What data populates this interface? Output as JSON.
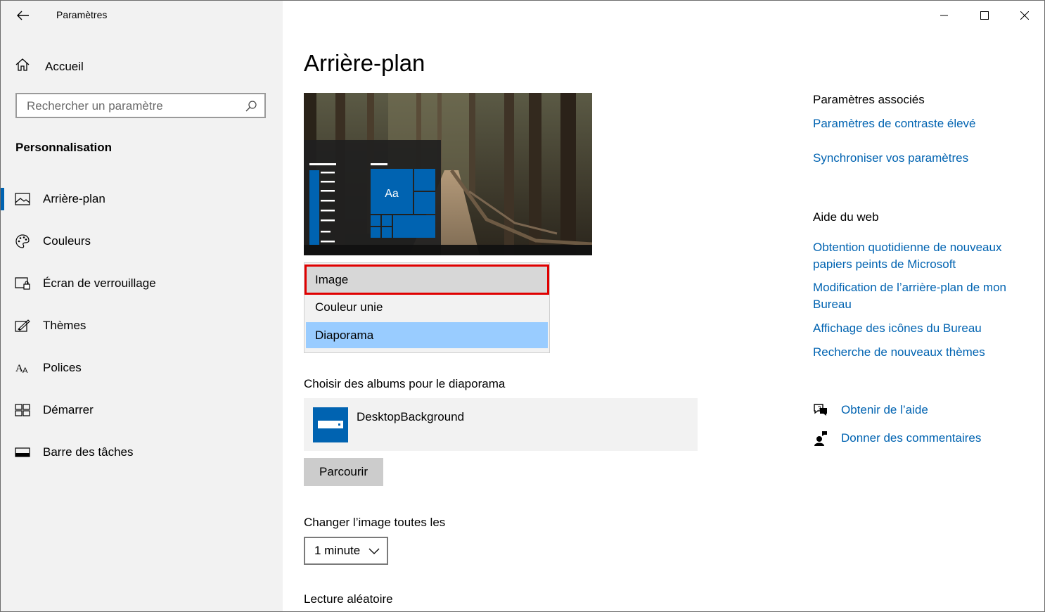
{
  "window": {
    "title": "Paramètres",
    "controls": [
      "minimize",
      "maximize",
      "close"
    ]
  },
  "sidebar": {
    "home_label": "Accueil",
    "search_placeholder": "Rechercher un paramètre",
    "section_title": "Personnalisation",
    "items": [
      {
        "label": "Arrière-plan",
        "icon": "picture-icon",
        "selected": true
      },
      {
        "label": "Couleurs",
        "icon": "palette-icon",
        "selected": false
      },
      {
        "label": "Écran de verrouillage",
        "icon": "lock-screen-icon",
        "selected": false
      },
      {
        "label": "Thèmes",
        "icon": "themes-icon",
        "selected": false
      },
      {
        "label": "Polices",
        "icon": "fonts-icon",
        "selected": false
      },
      {
        "label": "Démarrer",
        "icon": "start-icon",
        "selected": false
      },
      {
        "label": "Barre des tâches",
        "icon": "taskbar-icon",
        "selected": false
      }
    ]
  },
  "main": {
    "title": "Arrière-plan",
    "preview_tile_text": "Aa",
    "background_dropdown": {
      "options": [
        "Image",
        "Couleur unie",
        "Diaporama"
      ],
      "highlighted": "Image",
      "selected": "Diaporama"
    },
    "albums_label": "Choisir des albums pour le diaporama",
    "album_name": "DesktopBackground",
    "browse_button": "Parcourir",
    "interval_label": "Changer l’image toutes les",
    "interval_value": "1 minute",
    "shuffle_label": "Lecture aléatoire"
  },
  "related": {
    "heading": "Paramètres associés",
    "links": [
      "Paramètres de contraste élevé",
      "Synchroniser vos paramètres"
    ]
  },
  "web_help": {
    "heading": "Aide du web",
    "links": [
      "Obtention quotidienne de nouveaux papiers peints de Microsoft",
      "Modification de l’arrière-plan de mon Bureau",
      "Affichage des icônes du Bureau",
      "Recherche de nouveaux thèmes"
    ]
  },
  "support": {
    "get_help": "Obtenir de l’aide",
    "feedback": "Donner des commentaires"
  },
  "colors": {
    "accent": "#0063b1",
    "dropdown_highlight_border": "#e00000",
    "dropdown_selected": "#99ccff"
  }
}
